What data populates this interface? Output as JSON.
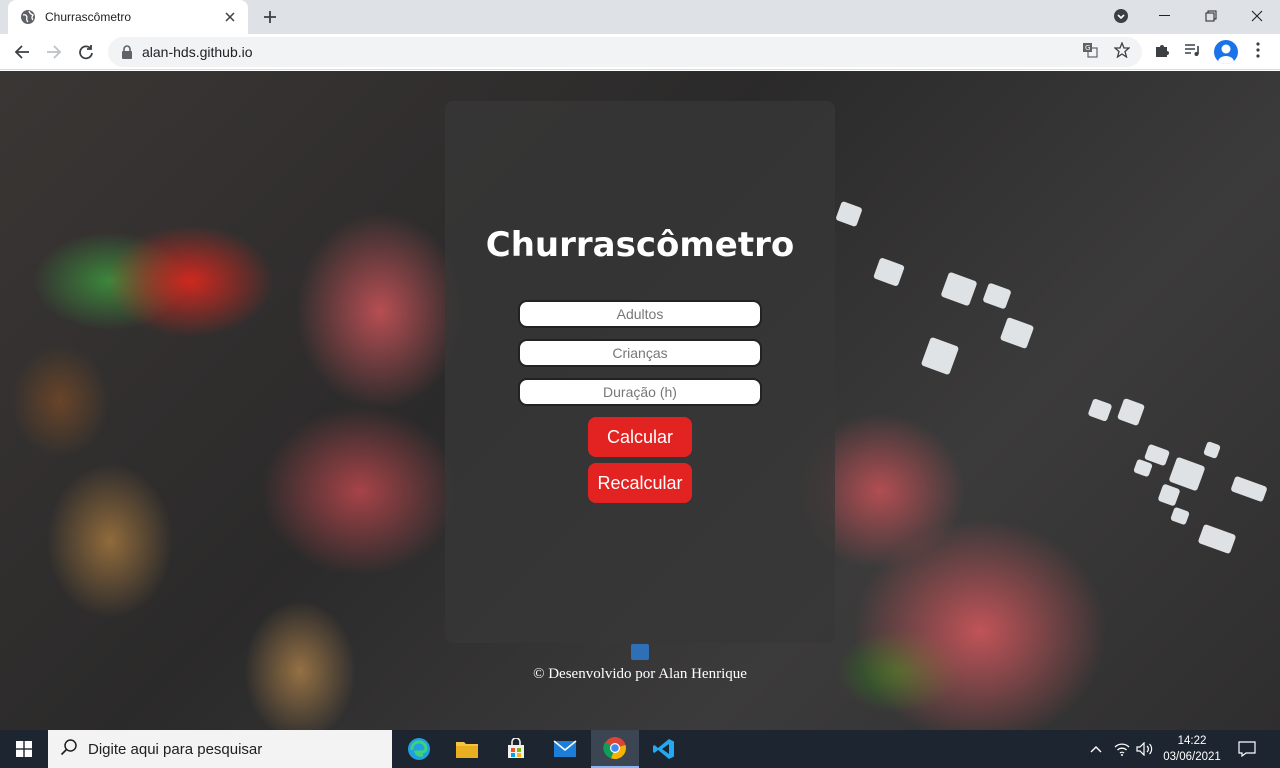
{
  "browser": {
    "tab_title": "Churrascômetro",
    "url": "alan-hds.github.io"
  },
  "page": {
    "title": "Churrascômetro",
    "fields": [
      {
        "placeholder": "Adultos"
      },
      {
        "placeholder": "Crianças"
      },
      {
        "placeholder": "Duração (h)"
      }
    ],
    "calc_button": "Calcular",
    "recalc_button": "Recalcular",
    "footer": "© Desenvolvido por Alan Henrique",
    "accent_color": "#e32222"
  },
  "taskbar": {
    "search_placeholder": "Digite aqui para pesquisar",
    "time": "14:22",
    "date": "03/06/2021"
  }
}
